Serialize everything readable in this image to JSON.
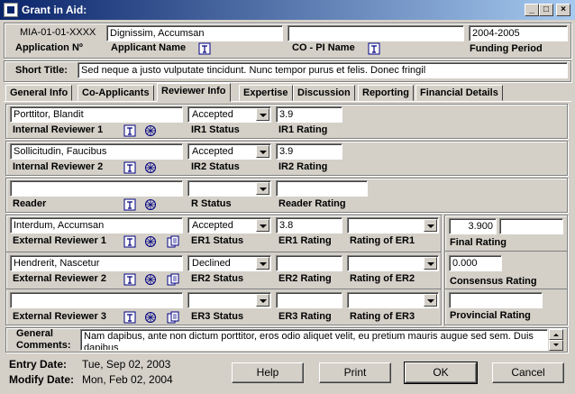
{
  "window": {
    "title": "Grant in Aid:",
    "min": "_",
    "max": "□",
    "close": "×"
  },
  "header": {
    "app_number": "MIA-01-01-XXXX",
    "app_number_label": "Application Nº",
    "applicant_name": "Dignissim, Accumsan",
    "applicant_name_label": "Applicant Name",
    "co_pi_name": "",
    "co_pi_label": "CO - PI Name",
    "funding_period": "2004-2005",
    "funding_period_label": "Funding Period"
  },
  "short_title": {
    "label": "Short Title:",
    "value": "Sed neque a justo vulputate tincidunt. Nunc tempor purus et felis. Donec fringil"
  },
  "tabs": [
    {
      "label": "General Info"
    },
    {
      "label": "Co-Applicants"
    },
    {
      "label": "Reviewer Info"
    },
    {
      "label": "Expertise"
    },
    {
      "label": "Discussion"
    },
    {
      "label": "Reporting"
    },
    {
      "label": "Financial Details"
    }
  ],
  "reviewers": {
    "ir1": {
      "name": "Porttitor, Blandit",
      "label": "Internal Reviewer 1",
      "status": "Accepted",
      "status_label": "IR1 Status",
      "rating": "3.9",
      "rating_label": "IR1 Rating"
    },
    "ir2": {
      "name": "Sollicitudin, Faucibus",
      "label": "Internal Reviewer 2",
      "status": "Accepted",
      "status_label": "IR2 Status",
      "rating": "3.9",
      "rating_label": "IR2 Rating"
    },
    "reader": {
      "name": "",
      "label": "Reader",
      "status": "",
      "status_label": "R Status",
      "rating": "",
      "rating_label": "Reader Rating"
    },
    "er1": {
      "name": "Interdum, Accumsan",
      "label": "External Reviewer 1",
      "status": "Accepted",
      "status_label": "ER1 Status",
      "rating": "3.8",
      "rating_label": "ER1 Rating",
      "rating_of": "",
      "rating_of_label": "Rating of ER1"
    },
    "er2": {
      "name": "Hendrerit, Nascetur",
      "label": "External Reviewer 2",
      "status": "Declined",
      "status_label": "ER2 Status",
      "rating": "",
      "rating_label": "ER2 Rating",
      "rating_of": "",
      "rating_of_label": "Rating of ER2"
    },
    "er3": {
      "name": "",
      "label": "External Reviewer 3",
      "status": "",
      "status_label": "ER3 Status",
      "rating": "",
      "rating_label": "ER3 Rating",
      "rating_of": "",
      "rating_of_label": "Rating of ER3"
    }
  },
  "summary": {
    "final_rating": "3.900",
    "final_rating_extra": "",
    "final_rating_label": "Final Rating",
    "consensus_rating": "0.000",
    "consensus_rating_label": "Consensus Rating",
    "provincial_rating": "",
    "provincial_rating_label": "Provincial Rating"
  },
  "comments": {
    "label_line1": "General",
    "label_line2": "Comments:",
    "value": "Nam dapibus, ante non dictum porttitor, eros odio aliquet velit, eu pretium mauris augue sed sem. Duis dapibus"
  },
  "footer": {
    "entry_label": "Entry Date:",
    "entry_value": "Tue, Sep 02, 2003",
    "modify_label": "Modify Date:",
    "modify_value": "Mon, Feb 02, 2004",
    "help": "Help",
    "print": "Print",
    "ok": "OK",
    "cancel": "Cancel"
  }
}
